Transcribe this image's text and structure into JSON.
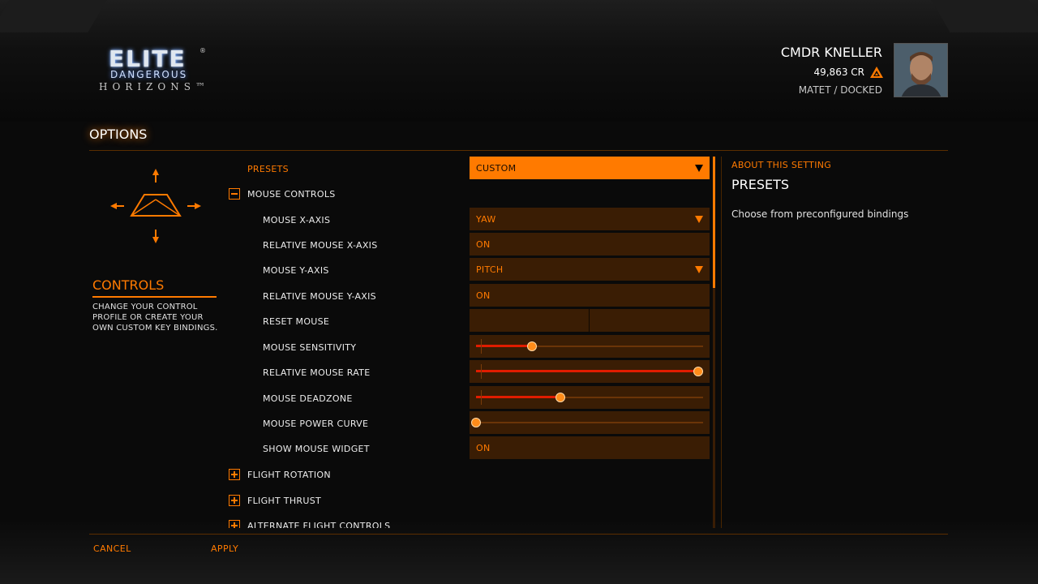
{
  "logo": {
    "elite": "ELITE",
    "dangerous": "DANGEROUS",
    "horizons": "HORIZONS™",
    "reg": "®"
  },
  "commander": {
    "name": "CMDR KNELLER",
    "credits": "49,863 CR",
    "location": "MATET / DOCKED"
  },
  "page": {
    "title": "OPTIONS"
  },
  "category": {
    "title": "CONTROLS",
    "description": "CHANGE YOUR CONTROL PROFILE OR CREATE YOUR OWN CUSTOM KEY BINDINGS."
  },
  "settings": {
    "presets": {
      "label": "PRESETS",
      "value": "CUSTOM"
    },
    "mouse_controls": {
      "label": "MOUSE CONTROLS",
      "expanded": true
    },
    "mouse_x_axis": {
      "label": "MOUSE X-AXIS",
      "value": "YAW"
    },
    "relative_mouse_x_axis": {
      "label": "RELATIVE MOUSE X-AXIS",
      "value": "ON"
    },
    "mouse_y_axis": {
      "label": "MOUSE Y-AXIS",
      "value": "PITCH"
    },
    "relative_mouse_y_axis": {
      "label": "RELATIVE MOUSE Y-AXIS",
      "value": "ON"
    },
    "reset_mouse": {
      "label": "RESET MOUSE"
    },
    "mouse_sensitivity": {
      "label": "MOUSE SENSITIVITY",
      "level": 0.25
    },
    "relative_mouse_rate": {
      "label": "RELATIVE MOUSE RATE",
      "level": 1.0
    },
    "mouse_deadzone": {
      "label": "MOUSE DEADZONE",
      "level": 0.38
    },
    "mouse_power_curve": {
      "label": "MOUSE POWER CURVE",
      "level": 0.0
    },
    "show_mouse_widget": {
      "label": "SHOW MOUSE WIDGET",
      "value": "ON"
    },
    "flight_rotation": {
      "label": "FLIGHT ROTATION",
      "expanded": false
    },
    "flight_thrust": {
      "label": "FLIGHT THRUST",
      "expanded": false
    },
    "alternate_flight_controls": {
      "label": "ALTERNATE FLIGHT CONTROLS",
      "expanded": false
    }
  },
  "about": {
    "heading": "ABOUT THIS SETTING",
    "title": "PRESETS",
    "description": "Choose from preconfigured bindings"
  },
  "footer": {
    "cancel": "CANCEL",
    "apply": "APPLY"
  },
  "colors": {
    "accent": "#ff7a00",
    "slider_fill": "#e01c00",
    "control_bg": "#3a1d04"
  }
}
